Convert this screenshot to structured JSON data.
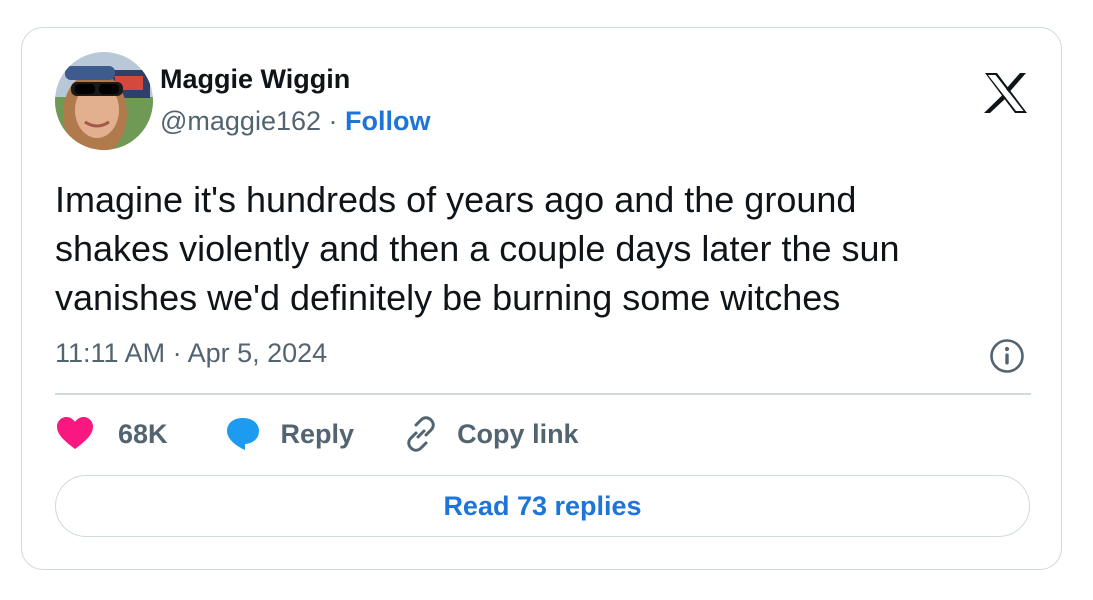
{
  "author": {
    "name": "Maggie Wiggin",
    "handle": "@maggie162",
    "separator": " · ",
    "follow_label": "Follow",
    "avatar_icon": "avatar-photo"
  },
  "brand": {
    "logo_icon": "x-logo-icon"
  },
  "tweet": {
    "text": "Imagine it's hundreds of years ago and the ground\nshakes violently and then a couple days later the sun\nvanishes we'd definitely be burning some witches",
    "timestamp": "11:11 AM · Apr 5, 2024"
  },
  "actions": {
    "like_count": "68K",
    "reply_label": "Reply",
    "copy_link_label": "Copy link"
  },
  "footer": {
    "read_replies_label": "Read 73 replies"
  },
  "colors": {
    "link_blue": "#1d74d9",
    "like_pink": "#f91880",
    "reply_blue": "#1d9bf0",
    "secondary_text": "#536471",
    "border": "#cfd9de"
  }
}
